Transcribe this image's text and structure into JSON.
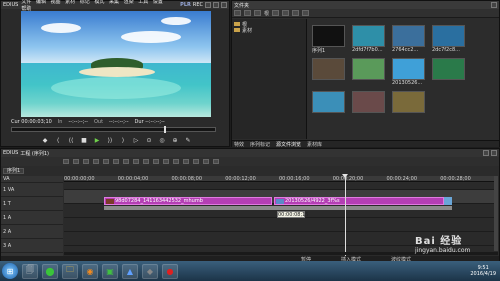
{
  "player": {
    "app_name": "EDIUS",
    "menu": [
      "文件",
      "编辑",
      "视图",
      "素材",
      "标记",
      "模式",
      "采集",
      "渲染",
      "工具",
      "设置",
      "帮助"
    ],
    "plr_label": "PLR",
    "rec_label": "REC",
    "timecodes": {
      "cur": "Cur 00:00:03;10",
      "in_label": "In",
      "in_val": "--:--:--;--",
      "out_label": "Out",
      "out_val": "--:--:--;--",
      "dur": "Dur --:--:--;--"
    },
    "scrub_position": 0.75,
    "controls": [
      "◆",
      "⟨",
      "⟨⟨",
      "■",
      "▶",
      "⟩⟩",
      "⟩",
      "▷",
      "⊙",
      "◎",
      "⊕",
      "✎"
    ]
  },
  "bin": {
    "title": "文件夹",
    "toolbar_title": "根",
    "folders": [
      {
        "label": "根"
      },
      {
        "label": "素材"
      }
    ],
    "clips": [
      {
        "label": "序列1",
        "color": "#111111"
      },
      {
        "label": "2dfd7f7b0...",
        "color": "#2e8fa8"
      },
      {
        "label": "2764cc2...",
        "color": "#3b6f9c"
      },
      {
        "label": "2dc7f2c8...",
        "color": "#2a6fa0"
      },
      {
        "label": "",
        "color": "#5a4a3a"
      },
      {
        "label": "",
        "color": "#5a9a5a"
      },
      {
        "label": "20130526...",
        "color": "#3fa0d8"
      },
      {
        "label": "",
        "color": "#2a7a4a"
      },
      {
        "label": "",
        "color": "#3b8fb8"
      },
      {
        "label": "",
        "color": "#6a4a4a"
      },
      {
        "label": "",
        "color": "#7a6a3a"
      }
    ],
    "tabs": [
      {
        "label": "特效"
      },
      {
        "label": "序列标记"
      },
      {
        "label": "源文件浏览",
        "active": true
      },
      {
        "label": "素材库"
      }
    ]
  },
  "timeline": {
    "title": "EDIUS",
    "project": "工程 (序列1)",
    "tabs": [
      "序列1"
    ],
    "ruler": [
      "00:00:00;00",
      "00:00:04;00",
      "00:00:08;00",
      "00:00:12;00",
      "00:00:16;00",
      "00:00:20;00",
      "00:00:24;00",
      "00:00:28;00"
    ],
    "tracks": [
      {
        "name": "VA",
        "label": ""
      },
      {
        "name": "1 VA",
        "label": ""
      },
      {
        "name": "1 T",
        "label": ""
      },
      {
        "name": "1 A",
        "label": ""
      },
      {
        "name": "2 A",
        "label": ""
      },
      {
        "name": "3 A",
        "label": ""
      }
    ],
    "clips": [
      {
        "label": "98d07284_141163442532_mhumb",
        "track": 1,
        "start": 0.1,
        "end": 0.48
      },
      {
        "label": "20130526/4922_3f%s",
        "track": 1,
        "start": 0.5,
        "end": 0.89
      }
    ],
    "tooltip": "00:00:08;15",
    "status": [
      "暂停",
      "插入模式",
      "波纹模式"
    ]
  },
  "taskbar": {
    "apps": [
      "🗐",
      "⬤",
      "🗀",
      "◉",
      "▣",
      "▲",
      "◆",
      "●"
    ],
    "time": "9:51",
    "date": "2016/4/19"
  },
  "watermark": {
    "logo": "Bai 经验",
    "url": "jingyan.baidu.com"
  }
}
